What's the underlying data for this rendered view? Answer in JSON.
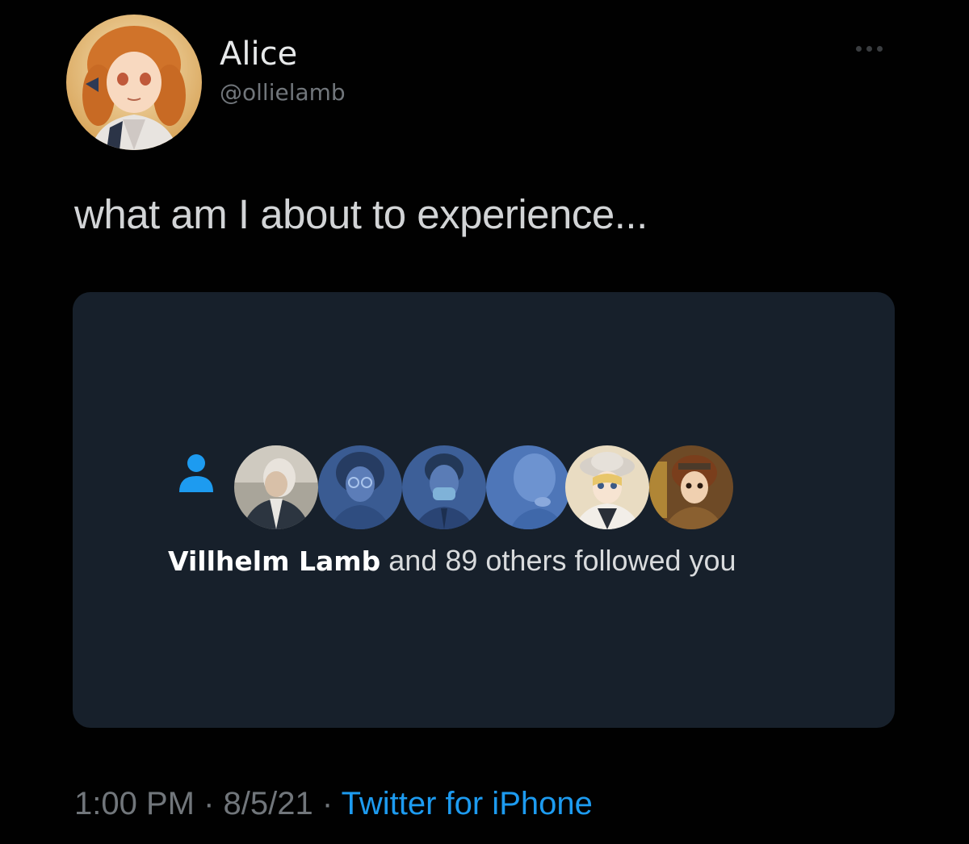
{
  "author": {
    "display_name": "Alice",
    "handle": "@ollielamb",
    "avatar_icon": "profile-avatar"
  },
  "more_menu": {
    "icon": "more-options-icon"
  },
  "tweet": {
    "text": "what am I about to experience..."
  },
  "notification": {
    "icon": "person-icon",
    "name": "Villhelm Lamb",
    "rest": "and 89 others followed you",
    "accent_color": "#1d9bf0"
  },
  "footer": {
    "time": "1:00 PM",
    "separator": "·",
    "date": "8/5/21",
    "source": "Twitter for iPhone"
  },
  "colors": {
    "background": "#000000",
    "card": "#17202b",
    "link": "#1d9bf0",
    "muted": "#71767b"
  }
}
